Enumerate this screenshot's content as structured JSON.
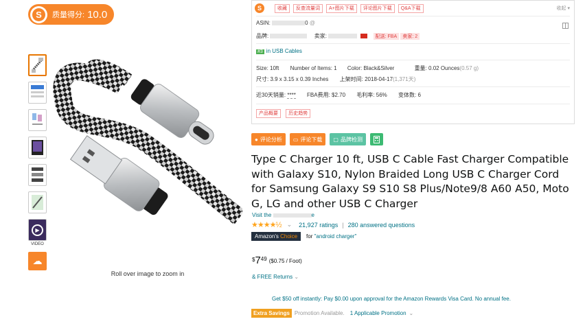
{
  "score": {
    "logo": "S",
    "label": "质量得分:",
    "value": "10.0"
  },
  "thumbnails": {
    "video_label": "VIDEO"
  },
  "image": {
    "zoom_hint": "Roll over image to zoom in"
  },
  "panel": {
    "logo": "S",
    "tags": [
      "收藏",
      "反查流量词",
      "A+图片下载",
      "评论图片下载",
      "Q&A下载"
    ],
    "collapse": "收起 ▾",
    "asin_label": "ASIN:",
    "asin_suffix": "0",
    "brand_label": "品牌:",
    "seller_label": "卖家:",
    "delivery": "配送: FBA",
    "seller_count": "卖家: 2",
    "rank_num": "#3",
    "rank_category": "in USB Cables",
    "size": "Size: 10ft",
    "items": "Number of Items: 1",
    "color": "Color: Black&Silver",
    "weight_label": "重量:",
    "weight_value": "0.02 Ounces",
    "weight_alt": "(0.57 g)",
    "dimensions": "尺寸: 3.9 x 3.15 x 0.39 Inches",
    "listed_label": "上架时间:",
    "listed_value": "2018-04-17",
    "listed_days": "(1,371天)",
    "sales_label": "近30天销量:",
    "sales_value": "****",
    "fba_fee": "FBA费用: $2.70",
    "margin": "毛利率: 56%",
    "variants": "变体数: 6",
    "trend_tags": [
      "产品概要",
      "历史趋势"
    ]
  },
  "actions": {
    "review_analysis": "评论分析",
    "review_download": "评论下载",
    "brand_check": "品牌检测",
    "calculator_icon": "calculator-icon"
  },
  "product": {
    "title": "Type C Charger 10 ft, USB C Cable Fast Charger Compatible with Galaxy S10, Nylon Braided Long USB C Charger Cord for Samsung Galaxy S9 S10 S8 Plus/Note9/8 A60 A50, Moto G, LG and other USB C Charger",
    "store_prefix": "Visit the",
    "store_suffix": "e",
    "stars": "★★★★½",
    "ratings": "21,927 ratings",
    "answered": "280 answered questions",
    "choice_prefix": "Amazon's",
    "choice_word": "Choice",
    "choice_for": "for",
    "choice_query": "\"android charger\"",
    "price_symbol": "$",
    "price_whole": "7",
    "price_fraction": "49",
    "price_unit": "($0.75 / Foot)",
    "returns": "& FREE Returns",
    "promo": "Get $50 off instantly: Pay $0.00 upon approval for the Amazon Rewards Visa Card. No annual fee.",
    "savings_badge": "Extra Savings",
    "promotion_text": "Promotion Available.",
    "applicable": "1 Applicable Promotion"
  },
  "colors": {
    "accent": "#f7862a",
    "link": "#007185",
    "star": "#ffa41c"
  }
}
